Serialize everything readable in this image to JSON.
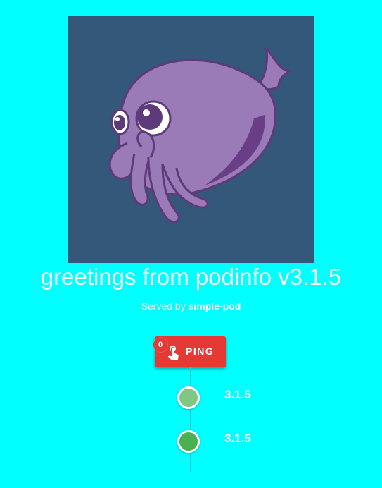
{
  "mascot": {
    "icon": "octopus-mascot-icon",
    "background": "#34587A"
  },
  "header": {
    "title": "greetings from podinfo v3.1.5",
    "served_prefix": "Served by",
    "served_host": "simple-pod"
  },
  "ping": {
    "label": "PING",
    "count": "0",
    "icon": "touch-hand-icon",
    "color": "#E53935"
  },
  "timeline": {
    "items": [
      {
        "label": "3.1.5",
        "color": "#81C784"
      },
      {
        "label": "3.1.5",
        "color": "#4CAF50"
      }
    ]
  },
  "colors": {
    "page_background": "#00FFFF",
    "line": "#3DC1D3"
  }
}
